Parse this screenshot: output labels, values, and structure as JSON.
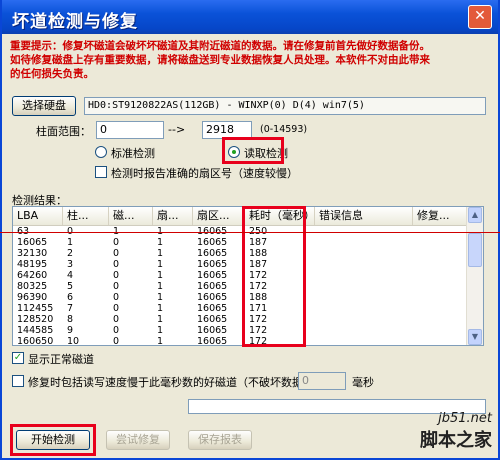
{
  "window": {
    "title": "坏道检测与修复",
    "close": "✕"
  },
  "warning": [
    "重要提示：修复坏磁道会破坏坏磁道及其附近磁道的数据。请在修复前首先做好数据备份。",
    "如待修复磁盘上存有重要数据，请将磁盘送到专业数据恢复人员处理。本软件不对由此带来",
    "的任何损失负责。"
  ],
  "disk": {
    "button": "选择硬盘",
    "info": "HD0:ST9120822AS(112GB) - WINXP(0) D(4) win7(5)"
  },
  "range": {
    "label": "柱面范围：",
    "from": "0",
    "arrow": "-->",
    "to": "2918",
    "hint": "(0-14593)"
  },
  "mode": {
    "standard": "标准检测",
    "read": "读取检测",
    "selected": "read"
  },
  "report_sector": {
    "label": "检测时报告准确的扇区号（速度较慢）",
    "checked": false
  },
  "results": {
    "label": "检测结果：",
    "columns": [
      "LBA",
      "柱...",
      "磁...",
      "扇...",
      "扇区...",
      "耗时（毫秒）",
      "错误信息",
      "修复..."
    ],
    "rows": [
      [
        "63",
        "0",
        "1",
        "1",
        "16065",
        "250"
      ],
      [
        "16065",
        "1",
        "0",
        "1",
        "16065",
        "187"
      ],
      [
        "32130",
        "2",
        "0",
        "1",
        "16065",
        "188"
      ],
      [
        "48195",
        "3",
        "0",
        "1",
        "16065",
        "187"
      ],
      [
        "64260",
        "4",
        "0",
        "1",
        "16065",
        "172"
      ],
      [
        "80325",
        "5",
        "0",
        "1",
        "16065",
        "172"
      ],
      [
        "96390",
        "6",
        "0",
        "1",
        "16065",
        "188"
      ],
      [
        "112455",
        "7",
        "0",
        "1",
        "16065",
        "171"
      ],
      [
        "128520",
        "8",
        "0",
        "1",
        "16065",
        "172"
      ],
      [
        "144585",
        "9",
        "0",
        "1",
        "16065",
        "172"
      ],
      [
        "160650",
        "10",
        "0",
        "1",
        "16065",
        "172"
      ]
    ]
  },
  "show_normal": {
    "label": "显示正常磁道",
    "checked": true
  },
  "repair_slow": {
    "label": "修复时包括读写速度慢于此毫秒数的好磁道（不破坏数据）：",
    "value": "0",
    "unit": "毫秒",
    "checked": false
  },
  "buttons": {
    "start": "开始检测",
    "try_repair": "尝试修复",
    "save_report": "保存报表"
  },
  "watermark": {
    "url": "jb51.net",
    "site": "脚本之家"
  },
  "colors": {
    "title": "#0a52d8",
    "highlight": "#e8001c",
    "warning": "#d00000"
  }
}
